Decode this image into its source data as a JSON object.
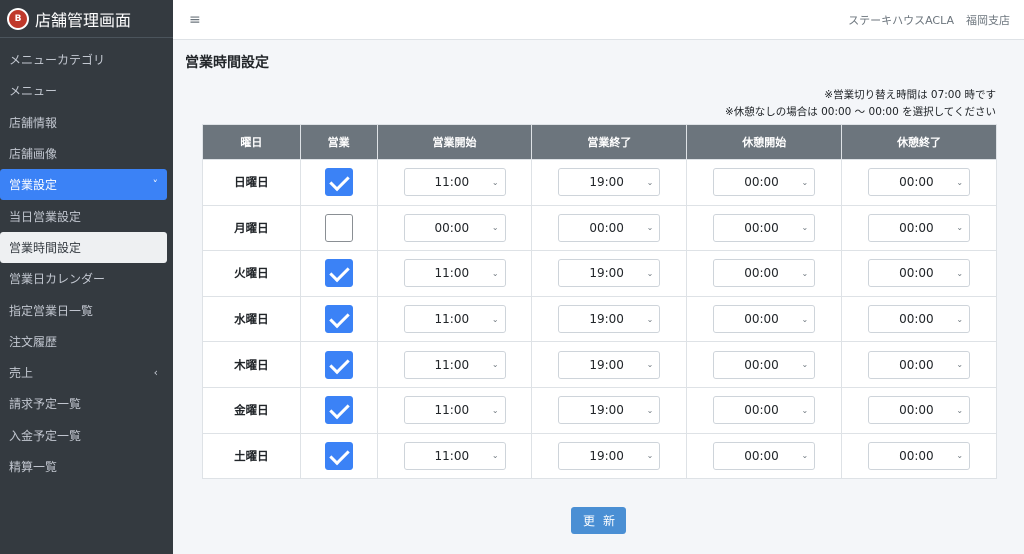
{
  "brand": {
    "logo_letter": "B",
    "title": "店舗管理画面"
  },
  "sidebar": {
    "items": [
      {
        "label": "メニューカテゴリ"
      },
      {
        "label": "メニュー"
      },
      {
        "label": "店舗情報"
      },
      {
        "label": "店舗画像"
      },
      {
        "label": "営業設定",
        "arrow": "˅"
      },
      {
        "label": "当日営業設定"
      },
      {
        "label": "営業時間設定"
      },
      {
        "label": "営業日カレンダー"
      },
      {
        "label": "指定営業日一覧"
      },
      {
        "label": "注文履歴"
      },
      {
        "label": "売上",
        "arrow": "‹"
      },
      {
        "label": "請求予定一覧"
      },
      {
        "label": "入金予定一覧"
      },
      {
        "label": "精算一覧"
      }
    ]
  },
  "topbar": {
    "menu_icon": "≡",
    "store_name": "ステーキハウスACLA",
    "branch": "福岡支店"
  },
  "page": {
    "title": "営業時間設定",
    "note1": "※営業切り替え時間は 07:00 時です",
    "note2": "※休憩なしの場合は 00:00 〜 00:00 を選択してください"
  },
  "table": {
    "headers": [
      "曜日",
      "営業",
      "営業開始",
      "営業終了",
      "休憩開始",
      "休憩終了"
    ],
    "rows": [
      {
        "day": "日曜日",
        "open": true,
        "start": "11:00",
        "end": "19:00",
        "break_start": "00:00",
        "break_end": "00:00"
      },
      {
        "day": "月曜日",
        "open": false,
        "start": "00:00",
        "end": "00:00",
        "break_start": "00:00",
        "break_end": "00:00"
      },
      {
        "day": "火曜日",
        "open": true,
        "start": "11:00",
        "end": "19:00",
        "break_start": "00:00",
        "break_end": "00:00"
      },
      {
        "day": "水曜日",
        "open": true,
        "start": "11:00",
        "end": "19:00",
        "break_start": "00:00",
        "break_end": "00:00"
      },
      {
        "day": "木曜日",
        "open": true,
        "start": "11:00",
        "end": "19:00",
        "break_start": "00:00",
        "break_end": "00:00"
      },
      {
        "day": "金曜日",
        "open": true,
        "start": "11:00",
        "end": "19:00",
        "break_start": "00:00",
        "break_end": "00:00"
      },
      {
        "day": "土曜日",
        "open": true,
        "start": "11:00",
        "end": "19:00",
        "break_start": "00:00",
        "break_end": "00:00"
      }
    ]
  },
  "update_button": "更新",
  "colors": {
    "sidebar_bg": "#343a40",
    "accent": "#3b82f6",
    "header_bg": "#6c757d",
    "button": "#4a8fd4"
  }
}
